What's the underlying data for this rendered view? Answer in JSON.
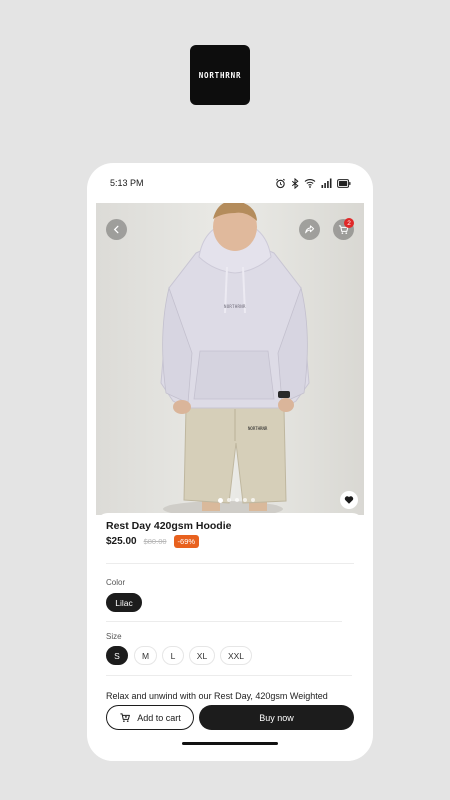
{
  "brand": {
    "logo_text": "NORTHRNR"
  },
  "status_bar": {
    "time": "5:13 PM"
  },
  "header": {
    "cart_count": "2"
  },
  "carousel": {
    "total": 5,
    "active": 0
  },
  "product": {
    "title": "Rest Day 420gsm Hoodie",
    "price": "$25.00",
    "original_price": "$80.00",
    "discount": "-69%",
    "chest_print": "NORTHRNR",
    "shorts_print": "NORTHRNR"
  },
  "color": {
    "label": "Color",
    "options": [
      "Lilac"
    ],
    "selected": "Lilac"
  },
  "size": {
    "label": "Size",
    "options": [
      "S",
      "M",
      "L",
      "XL",
      "XXL"
    ],
    "selected": "S"
  },
  "description": "Relax and unwind with our Rest Day, 420gsm Weighted",
  "actions": {
    "add_to_cart": "Add to cart",
    "buy_now": "Buy now"
  },
  "colors": {
    "accent": "#1c1c1c",
    "discount": "#e8611e",
    "badge": "#e02828",
    "hoodie": "#dddbe6",
    "shorts": "#d6cfb9"
  }
}
